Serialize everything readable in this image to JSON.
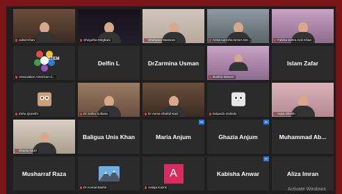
{
  "tiles": [
    {
      "label": "Jahid Khan",
      "type": "video",
      "scene": "office"
    },
    {
      "label": "Sheguftta Mirghani",
      "type": "video",
      "scene": "dark"
    },
    {
      "label": "Shahpara Mansoor",
      "type": "video",
      "scene": "light"
    },
    {
      "label": "Amra Lamzha NASA Ser...",
      "type": "video",
      "scene": "room"
    },
    {
      "label": "Fatima Zahra Aziz Khan",
      "type": "video",
      "scene": "purple"
    },
    {
      "label": "Association American d...",
      "type": "logo",
      "logo_text": "STEM"
    },
    {
      "name": "Delfin L",
      "type": "name"
    },
    {
      "name": "DrZarmina Usman",
      "type": "name"
    },
    {
      "label": "Bushra Naeem",
      "type": "photo",
      "scene": "purple"
    },
    {
      "name": "Islam Zafar",
      "type": "name"
    },
    {
      "label": "Zoha Qureshi",
      "type": "owl"
    },
    {
      "label": "Dr Sahia Sultana",
      "type": "video",
      "scene": "warm"
    },
    {
      "label": "Dr Asma Shahid Kazi",
      "type": "video",
      "scene": "office",
      "active": true
    },
    {
      "label": "Eduardo Galindo",
      "type": "owlbw"
    },
    {
      "label": "Aqsa Sheikh",
      "type": "video",
      "scene": "pink"
    },
    {
      "label": "Shaziq Nazir",
      "type": "video",
      "scene": "sofa"
    },
    {
      "name": "Baligua Unis Khan",
      "type": "name"
    },
    {
      "name": "Maria Anjum",
      "type": "name",
      "badge": true
    },
    {
      "name": "Ghazia Anjum",
      "type": "name",
      "badge": true
    },
    {
      "name": "Muhammad Ab...",
      "type": "name"
    },
    {
      "name": "Musharraf Raza",
      "type": "name"
    },
    {
      "label": "Dr Komal Bashir",
      "type": "mountain"
    },
    {
      "label": "Aatiqa Kazmi",
      "type": "avatar",
      "initial": "A"
    },
    {
      "name": "Kabisha Anwar",
      "type": "name",
      "badge": true
    },
    {
      "name": "Aliza Imran",
      "type": "name"
    }
  ],
  "watermark": "Activate Windows",
  "colors": {
    "outer": "#7a1416",
    "accent_active": "#c8d84e",
    "avatar": "#d62d5e",
    "badge": "#2a7be4"
  }
}
